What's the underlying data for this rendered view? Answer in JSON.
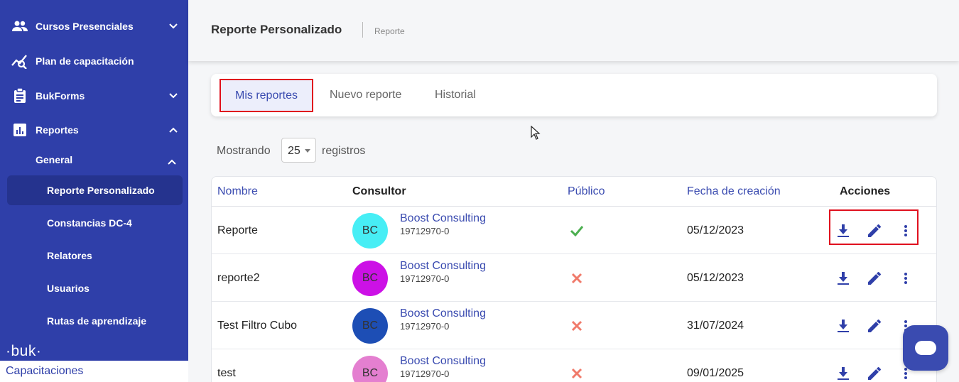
{
  "sidebar": {
    "items": [
      {
        "label": "Cursos Presenciales",
        "icon": "people-icon",
        "chevron": "down"
      },
      {
        "label": "Plan de capacitación",
        "icon": "analytics-icon"
      },
      {
        "label": "BukForms",
        "icon": "clipboard-icon",
        "chevron": "down"
      },
      {
        "label": "Reportes",
        "icon": "bar-chart-icon",
        "chevron": "up"
      }
    ],
    "group_label": "General",
    "sub_items": [
      {
        "label": "Reporte Personalizado",
        "active": true
      },
      {
        "label": "Constancias DC-4"
      },
      {
        "label": "Relatores"
      },
      {
        "label": "Usuarios"
      },
      {
        "label": "Rutas de aprendizaje"
      }
    ],
    "brand_logo": "·buk·",
    "brand_name": "Capacitaciones"
  },
  "header": {
    "title": "Reporte Personalizado",
    "breadcrumb": "Reporte"
  },
  "tabs": [
    {
      "label": "Mis reportes",
      "active": true
    },
    {
      "label": "Nuevo reporte"
    },
    {
      "label": "Historial"
    }
  ],
  "entries": {
    "prefix": "Mostrando",
    "value": "25",
    "suffix": "registros"
  },
  "table": {
    "columns": [
      "Nombre",
      "Consultor",
      "Público",
      "Fecha de creación",
      "Acciones"
    ],
    "rows": [
      {
        "name": "Reporte",
        "initials": "BC",
        "avatar_color": "#47eef5",
        "consultant": "Boost Consulting",
        "rut": "19712970-0",
        "public": true,
        "date": "05/12/2023"
      },
      {
        "name": "reporte2",
        "initials": "BC",
        "avatar_color": "#cc11e6",
        "consultant": "Boost Consulting",
        "rut": "19712970-0",
        "public": false,
        "date": "05/12/2023"
      },
      {
        "name": "Test Filtro Cubo",
        "initials": "BC",
        "avatar_color": "#1d4eb5",
        "consultant": "Boost Consulting",
        "rut": "19712970-0",
        "public": false,
        "date": "31/07/2024"
      },
      {
        "name": "test",
        "initials": "BC",
        "avatar_color": "#e47fd0",
        "consultant": "Boost Consulting",
        "rut": "19712970-0",
        "public": false,
        "date": "09/01/2025"
      }
    ]
  },
  "colors": {
    "sidebar_bg": "#2f3fa9",
    "accent": "#3a4bb0",
    "highlight": "#e0101e",
    "check": "#4caf50",
    "cross": "#f07a6a"
  }
}
